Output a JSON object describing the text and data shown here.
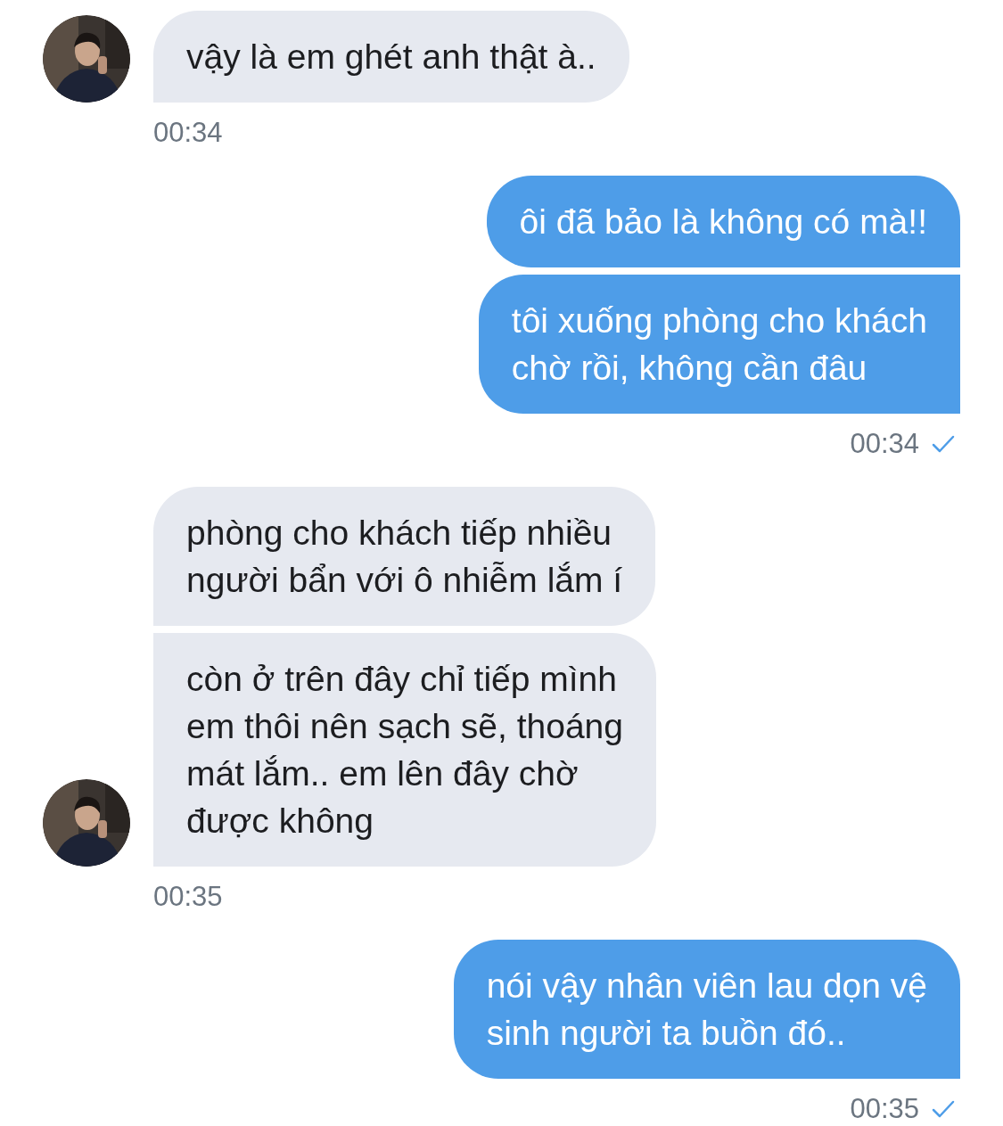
{
  "messages": [
    {
      "kind": "received",
      "bubbles": [
        "vậy là em ghét anh thật à.."
      ],
      "time": "00:34"
    },
    {
      "kind": "sent",
      "bubbles": [
        "ôi đã bảo là không có mà!!",
        "tôi xuống phòng cho khách\nchờ rồi, không cần đâu"
      ],
      "time": "00:34",
      "read": true
    },
    {
      "kind": "received",
      "bubbles": [
        "phòng cho khách tiếp nhiều\nngười bẩn với ô nhiễm lắm í",
        "còn ở trên đây chỉ tiếp mình\nem thôi nên sạch sẽ, thoáng\nmát lắm.. em lên đây chờ\nđược không"
      ],
      "time": "00:35"
    },
    {
      "kind": "sent",
      "bubbles": [
        "nói vậy nhân viên lau dọn vệ\nsinh người ta buồn đó.."
      ],
      "time": "00:35",
      "read": true
    }
  ]
}
